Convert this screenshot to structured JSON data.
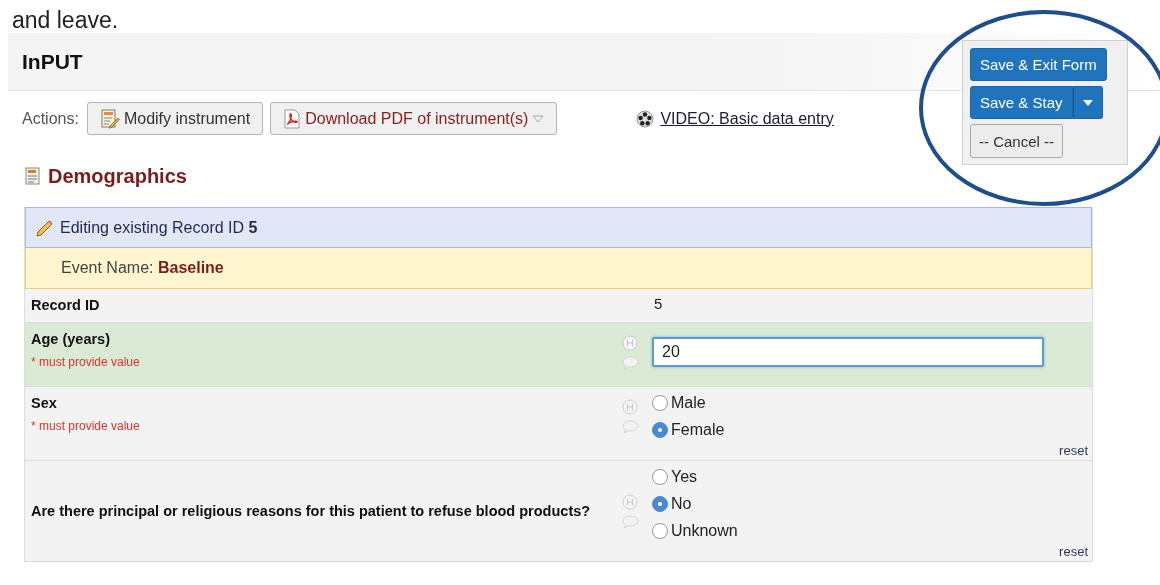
{
  "intro_text": "and leave.",
  "app_title": "InPUT",
  "actions": {
    "label": "Actions:",
    "buttons": [
      {
        "label": "Modify instrument",
        "kind": "modify"
      },
      {
        "label": "Download PDF of instrument(s)",
        "kind": "pdf"
      }
    ],
    "video_link": "VIDEO: Basic data entry"
  },
  "save_panel": {
    "buttons": [
      {
        "label": "Save & Exit Form",
        "kind": "primary"
      },
      {
        "label": "Save & Stay",
        "kind": "split"
      },
      {
        "label": "-- Cancel --",
        "kind": "secondary"
      }
    ]
  },
  "form": {
    "title": "Demographics",
    "editing_notice": "Editing existing Record ID **5**",
    "event": "Event Name: **Baseline**",
    "fields": [
      {
        "kind": "readonly",
        "label": "Record ID",
        "value": "5"
      },
      {
        "kind": "text",
        "label": "Age (years)",
        "required_note": "* must provide value",
        "value": "20",
        "focused": true
      },
      {
        "kind": "radio",
        "label": "Sex",
        "required_note": "* must provide value",
        "options": [
          {
            "label": "Male",
            "selected": false
          },
          {
            "label": "Female",
            "selected": true
          }
        ],
        "reset": "reset"
      },
      {
        "kind": "radio",
        "label": "Are there principal or religious reasons for this patient to refuse blood products?",
        "options": [
          {
            "label": "Yes",
            "selected": false
          },
          {
            "label": "No",
            "selected": true
          },
          {
            "label": "Unknown",
            "selected": false
          }
        ],
        "reset": "reset"
      }
    ]
  }
}
